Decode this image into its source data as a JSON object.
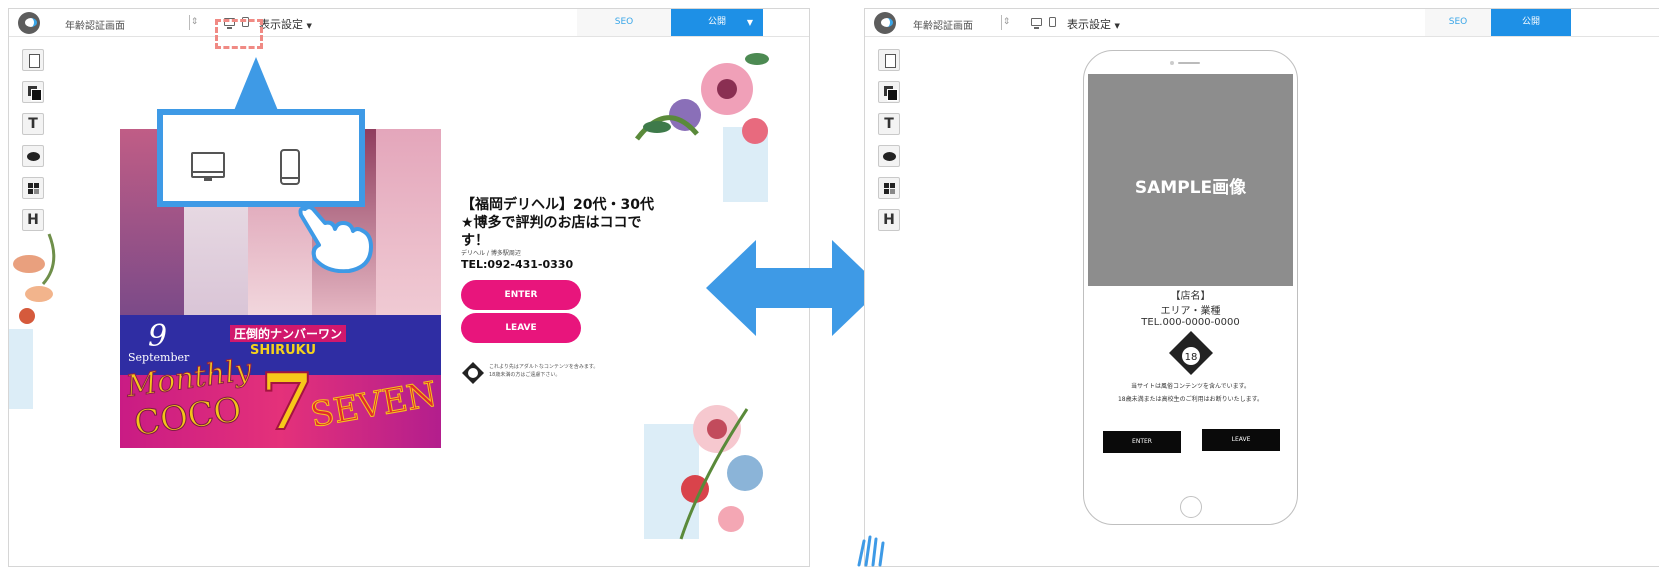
{
  "editor": {
    "page_name": "年齢認証画面",
    "display_settings": "表示設定",
    "display_caret": "▼",
    "seo_label": "SEO",
    "publish_label": "公開",
    "publish_caret": "▼",
    "tools": [
      "page-tool",
      "copy-tool",
      "T",
      "shape-tool",
      "grid-tool",
      "H"
    ],
    "accent_color": "#1e90e6"
  },
  "left_preview": {
    "poster": {
      "number": "9",
      "month": "September",
      "ranking": "圧倒的ナンバーワン",
      "shop_tag": "SHIRUKU",
      "monthly": "Monthly",
      "coco": "COCO",
      "seven_digit": "7",
      "seven_word": "SEVEN"
    },
    "title": "【福岡デリヘル】20代・30代★博多で評判のお店はココです！",
    "subtitle": "デリヘル / 博多駅周辺",
    "tel": "TEL:092-431-0330",
    "enter": "ENTER",
    "leave": "LEAVE",
    "notice_line1": "これより先はアダルトなコンテンツを含みます。",
    "notice_line2": "18歳未満の方はご遠慮下さい。",
    "button_color": "#e8157c"
  },
  "callout": {
    "desktop_icon": "desktop-icon",
    "mobile_icon": "mobile-icon",
    "pointer_icon": "hand-pointer-icon",
    "color": "#3e9ae6"
  },
  "transition_icon": "double-arrow-icon",
  "right_preview": {
    "sample": "SAMPLE画像",
    "shop_name": "【店名】",
    "area": "エリア・業種",
    "tel": "TEL.000-0000-0000",
    "age_badge": "18",
    "notice_line1": "当サイトは風俗コンテンツを含んでいます。",
    "notice_line2": "18歳未満または高校生のご利用はお断りいたします。",
    "enter": "ENTER",
    "leave": "LEAVE"
  }
}
